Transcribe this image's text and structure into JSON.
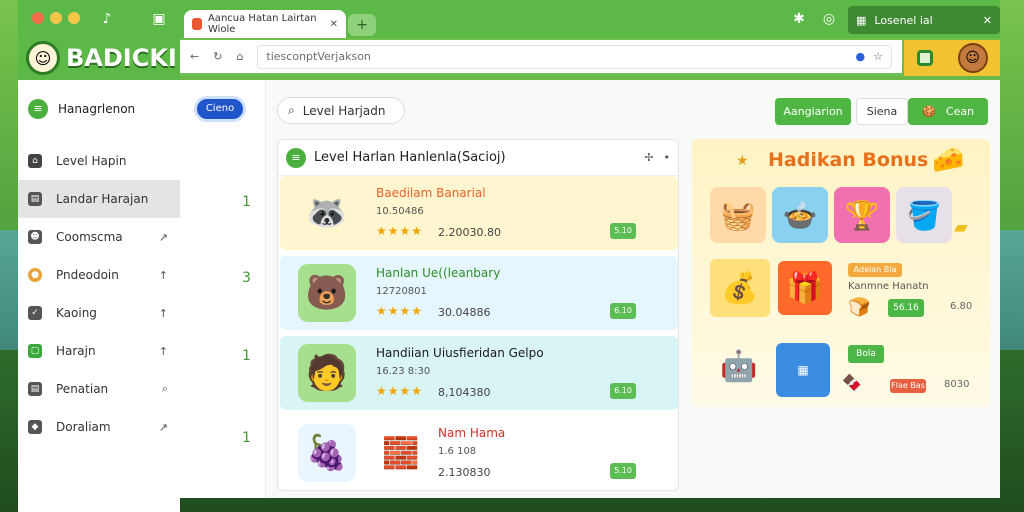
{
  "app": {
    "brand": "BADICKI"
  },
  "tab": {
    "title": "Aancua Hatan Lairtan Wiole"
  },
  "toolbar": {
    "user": "Losenel ial",
    "close": "✕"
  },
  "address": {
    "url": "tiesconptVerjakson"
  },
  "sidebar": {
    "header": "Hanagrlenon",
    "items": [
      {
        "label": "Level Hapin",
        "arrow": ""
      },
      {
        "label": "Landar Harajan",
        "arrow": ""
      },
      {
        "label": "Coomscma",
        "arrow": "↗"
      },
      {
        "label": "Pndeodoin",
        "arrow": "↑"
      },
      {
        "label": "Kaoing",
        "arrow": "↑"
      },
      {
        "label": "Harajn",
        "arrow": "↑"
      },
      {
        "label": "Penatian",
        "arrow": "⌕"
      },
      {
        "label": "Doraliam",
        "arrow": "↗"
      }
    ]
  },
  "counts": {
    "badge": "Cieno",
    "values": [
      "1",
      "3",
      "1",
      "1"
    ]
  },
  "search": {
    "placeholder": "Level Harjadn"
  },
  "buttons": {
    "primary": "Aangiarion",
    "secondary": "Siena",
    "third": "Cean"
  },
  "list": {
    "title": "Level Harlan Hanlenla(Sacioj)",
    "rows": [
      {
        "name": "Baedilam Banarial",
        "sub": "10.50486",
        "value": "2.20030.80",
        "tag": "5.10",
        "color": "#e0642b"
      },
      {
        "name": "Hanlan Ue((leanbary",
        "sub": "12720801",
        "value": "30.04886",
        "tag": "6.10",
        "color": "#2c8f26"
      },
      {
        "name": "Handiian Uiusfieridan Gelpo",
        "sub": "16.23 8:30",
        "value": "8,104380",
        "tag": "6.10",
        "color": "#1a1a1a"
      },
      {
        "name": "Nam Hama",
        "sub": "1.6 108",
        "value": "2.130830",
        "tag": "5.10",
        "color": "#d3322b"
      }
    ]
  },
  "bonus": {
    "title": "Hadikan Bonus",
    "tag1": "Adeian Bla",
    "label1": "Kanmne Hanatn",
    "green1": "56.16",
    "num1": "6.80",
    "tag2": "Flae Bas",
    "green2": "Bola",
    "num2": "8030"
  }
}
